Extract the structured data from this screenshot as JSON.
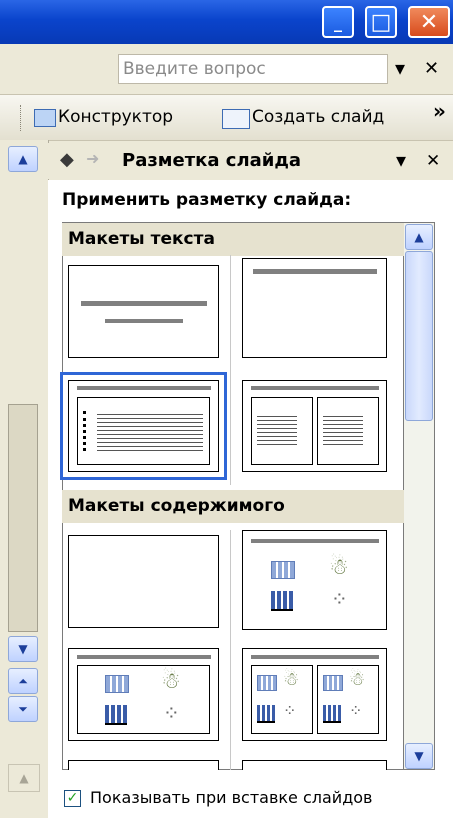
{
  "window": {
    "minimize_glyph": "_",
    "maximize_glyph": "□",
    "close_glyph": "✕"
  },
  "askbar": {
    "placeholder": "Введите вопрос",
    "dropdown_glyph": "▾",
    "close_glyph": "✕"
  },
  "toolbar": {
    "designer_label": "Конструктор",
    "new_slide_label": "Создать слайд",
    "overflow_glyph": "»"
  },
  "pane": {
    "back_glyph": "◆",
    "forward_glyph": "➜",
    "title": "Разметка слайда",
    "menu_glyph": "▾",
    "close_glyph": "✕",
    "apply_label": "Применить разметку слайда:",
    "sections": [
      {
        "title": "Макеты текста"
      },
      {
        "title": "Макеты содержимого"
      }
    ],
    "show_on_insert_label": "Показывать при вставке слайдов",
    "show_on_insert_checked": true
  },
  "colors": {
    "titlebar": "#0a44cc",
    "selection": "#2f66d6",
    "section_bg": "#e6e2cf"
  },
  "icons": [
    "minimize-icon",
    "maximize-icon",
    "close-icon",
    "designer-icon",
    "new-slide-icon",
    "back-icon",
    "forward-icon",
    "table-icon",
    "clipart-icon",
    "chart-icon",
    "diagram-icon"
  ]
}
